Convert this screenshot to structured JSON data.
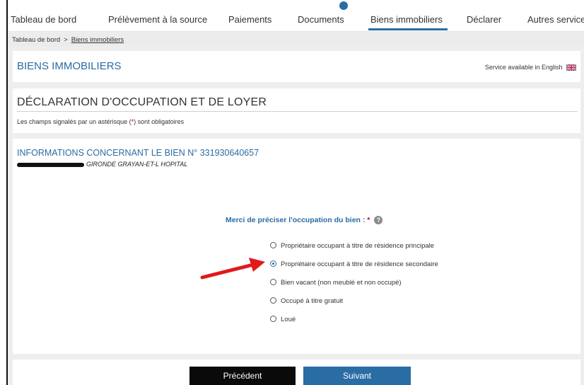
{
  "nav": {
    "items": [
      "Tableau de bord",
      "Prélèvement à la source",
      "Paiements",
      "Documents",
      "Biens immobiliers",
      "Déclarer",
      "Autres services"
    ],
    "active": "Biens immobiliers",
    "accent_color": "#2a6ca4"
  },
  "breadcrumb": {
    "home": "Tableau de bord",
    "separator": ">",
    "current": "Biens immobiliers"
  },
  "section_header": {
    "title": "BIENS IMMOBILIERS",
    "english_link": "Service available in English",
    "flag_icon": "uk-flag-icon"
  },
  "form_header": {
    "title": "DÉCLARATION D'OCCUPATION ET DE LOYER",
    "note_before": "Les champs signalés par un astérisque (",
    "note_star": "*",
    "note_after": ") sont obligatoires"
  },
  "property": {
    "title": "INFORMATIONS CONCERNANT LE BIEN N° 331930640657",
    "address": "GIRONDE GRAYAN-ET-L HOPITAL"
  },
  "question": {
    "label": "Merci de préciser l'occupation du bien :",
    "required_star": "*",
    "help_icon": "?"
  },
  "options": [
    {
      "label": "Propriétaire occupant à titre de résidence principale",
      "checked": false
    },
    {
      "label": "Propriétaire occupant à titre de résidence secondaire",
      "checked": true
    },
    {
      "label": "Bien vacant (non meublé et non occupé)",
      "checked": false
    },
    {
      "label": "Occupé à titre gratuit",
      "checked": false
    },
    {
      "label": "Loué",
      "checked": false
    }
  ],
  "buttons": {
    "previous": "Précédent",
    "next": "Suivant"
  },
  "colors": {
    "link_blue": "#2a6ca4",
    "required_red": "#cc0000",
    "annotation_arrow": "#e0191b"
  }
}
